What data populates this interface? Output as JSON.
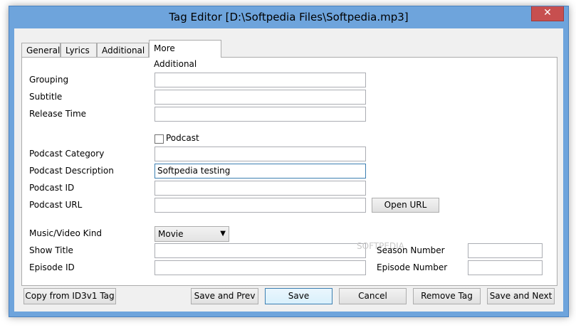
{
  "window": {
    "title": "Tag Editor [D:\\Softpedia Files\\Softpedia.mp3]",
    "close_glyph": "✕"
  },
  "tabs": [
    {
      "label": "General",
      "active": false
    },
    {
      "label": "Lyrics",
      "active": false
    },
    {
      "label": "Additional",
      "active": false
    },
    {
      "label": "More Additional",
      "active": true
    }
  ],
  "fields": {
    "grouping": {
      "label": "Grouping",
      "value": ""
    },
    "subtitle": {
      "label": "Subtitle",
      "value": ""
    },
    "release_time": {
      "label": "Release Time",
      "value": ""
    },
    "podcast_checkbox": {
      "label": "Podcast",
      "checked": false
    },
    "podcast_category": {
      "label": "Podcast Category",
      "value": ""
    },
    "podcast_description": {
      "label": "Podcast Description",
      "value": "Softpedia testing"
    },
    "podcast_id": {
      "label": "Podcast ID",
      "value": ""
    },
    "podcast_url": {
      "label": "Podcast URL",
      "value": ""
    },
    "music_video_kind": {
      "label": "Music/Video Kind",
      "selected": "Movie"
    },
    "show_title": {
      "label": "Show Title",
      "value": ""
    },
    "episode_id": {
      "label": "Episode ID",
      "value": ""
    },
    "season_number": {
      "label": "Season Number",
      "value": ""
    },
    "episode_number": {
      "label": "Episode Number",
      "value": ""
    }
  },
  "buttons": {
    "open_url": "Open URL",
    "copy_id3v1": "Copy from ID3v1 Tag",
    "save_prev": "Save and Prev",
    "save": "Save",
    "cancel": "Cancel",
    "remove_tag": "Remove Tag",
    "save_next": "Save and Next"
  },
  "watermark": "SOFTPEDIA"
}
